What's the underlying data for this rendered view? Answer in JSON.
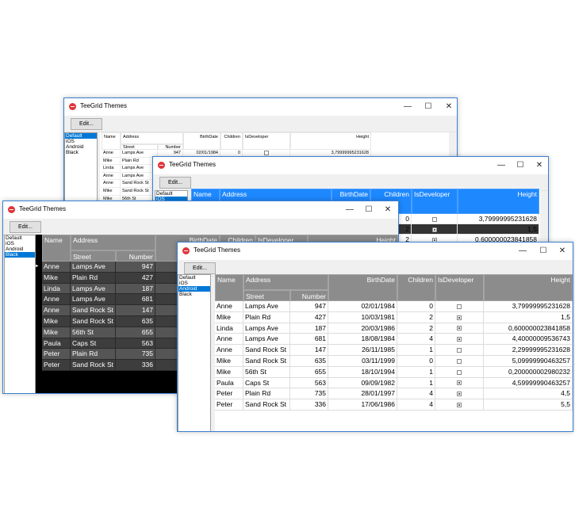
{
  "windows": {
    "default": {
      "title": "TeeGrid Themes",
      "edit_label": "Edit...",
      "minimize": "—",
      "maximize": "☐",
      "close": "✕"
    },
    "ios": {
      "title": "TeeGrid Themes",
      "edit_label": "Edit...",
      "minimize": "—",
      "maximize": "☐",
      "close": "✕"
    },
    "black": {
      "title": "TeeGrid Themes",
      "edit_label": "Edit...",
      "minimize": "—",
      "maximize": "☐",
      "close": "✕"
    },
    "android": {
      "title": "TeeGrid Themes",
      "edit_label": "Edit...",
      "minimize": "—",
      "maximize": "☐",
      "close": "✕"
    }
  },
  "themes": [
    "Default",
    "iOS",
    "Android",
    "Black"
  ],
  "selected_theme": {
    "default": "Default",
    "ios": "iOS",
    "black": "Black",
    "android": "Android"
  },
  "columns": {
    "name": "Name",
    "address": "Address",
    "street": "Street",
    "number": "Number",
    "birthdate": "BirthDate",
    "children": "Children",
    "isdeveloper": "IsDeveloper",
    "height": "Height"
  },
  "rows": [
    {
      "name": "Anne",
      "street": "Lamps Ave",
      "number": "947",
      "birthdate": "02/01/1984",
      "children": "0",
      "isdeveloper": false,
      "height": "3,79999995231628"
    },
    {
      "name": "Mike",
      "street": "Plain Rd",
      "number": "427",
      "birthdate": "10/03/1981",
      "children": "2",
      "isdeveloper": true,
      "height": "1,5"
    },
    {
      "name": "Linda",
      "street": "Lamps Ave",
      "number": "187",
      "birthdate": "20/03/1986",
      "children": "2",
      "isdeveloper": true,
      "height": "0,600000023841858"
    },
    {
      "name": "Anne",
      "street": "Lamps Ave",
      "number": "681",
      "birthdate": "18/08/1984",
      "children": "4",
      "isdeveloper": true,
      "height": "4,40000009536743"
    },
    {
      "name": "Anne",
      "street": "Sand Rock St",
      "number": "147",
      "birthdate": "26/11/1985",
      "children": "1",
      "isdeveloper": false,
      "height": "2,29999995231628"
    },
    {
      "name": "Mike",
      "street": "Sand Rock St",
      "number": "635",
      "birthdate": "03/11/1999",
      "children": "0",
      "isdeveloper": false,
      "height": "5,09999990463257"
    },
    {
      "name": "Mike",
      "street": "56th St",
      "number": "655",
      "birthdate": "18/10/1994",
      "children": "1",
      "isdeveloper": false,
      "height": "0,200000002980232"
    },
    {
      "name": "Paula",
      "street": "Caps St",
      "number": "563",
      "birthdate": "09/09/1982",
      "children": "1",
      "isdeveloper": true,
      "height": "4,59999990463257"
    },
    {
      "name": "Peter",
      "street": "Plain Rd",
      "number": "735",
      "birthdate": "28/01/1997",
      "children": "4",
      "isdeveloper": true,
      "height": "4,5"
    },
    {
      "name": "Peter",
      "street": "Sand Rock St",
      "number": "336",
      "birthdate": "17/06/1986",
      "children": "4",
      "isdeveloper": true,
      "height": "5,5"
    }
  ],
  "row_indicator": "►",
  "colors": {
    "ios_header": "#1e88ff",
    "android_header": "#8c8c8c",
    "black_bg": "#000000",
    "black_row": "#555555",
    "black_row_alt": "#3d3d3d",
    "selection": "#0078d7",
    "window_border": "#3b7fd0"
  }
}
